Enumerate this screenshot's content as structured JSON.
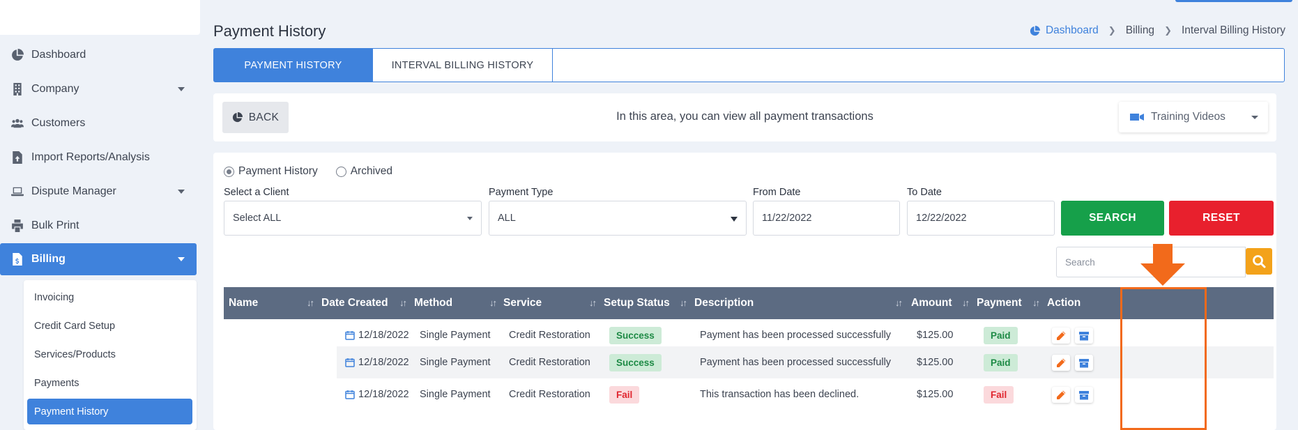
{
  "sidebar": {
    "items": [
      {
        "label": "Dashboard",
        "icon": "pie-chart-icon"
      },
      {
        "label": "Company",
        "icon": "building-icon"
      },
      {
        "label": "Customers",
        "icon": "users-icon"
      },
      {
        "label": "Import Reports/Analysis",
        "icon": "file-upload-icon"
      },
      {
        "label": "Dispute Manager",
        "icon": "laptop-icon"
      },
      {
        "label": "Bulk Print",
        "icon": "printer-icon"
      },
      {
        "label": "Billing",
        "icon": "invoice-icon"
      }
    ],
    "billing_submenu": [
      "Invoicing",
      "Credit Card Setup",
      "Services/Products",
      "Payments",
      "Payment History"
    ]
  },
  "header": {
    "title": "Payment History",
    "breadcrumb": [
      "Dashboard",
      "Billing",
      "Interval Billing History"
    ]
  },
  "tabs": [
    "PAYMENT HISTORY",
    "INTERVAL BILLING HISTORY"
  ],
  "info": {
    "back_label": "BACK",
    "text": "In this area, you can view all payment transactions",
    "training_label": "Training Videos"
  },
  "filters": {
    "radio_payment_history": "Payment History",
    "radio_archived": "Archived",
    "client_label": "Select a Client",
    "client_value": "Select ALL",
    "type_label": "Payment Type",
    "type_value": "ALL",
    "from_label": "From Date",
    "from_value": "11/22/2022",
    "to_label": "To Date",
    "to_value": "12/22/2022",
    "search_button": "SEARCH",
    "reset_button": "RESET",
    "search_placeholder": "Search"
  },
  "table": {
    "columns": [
      "Name",
      "Date Created",
      "Method",
      "Service",
      "Setup Status",
      "Description",
      "Amount",
      "Payment",
      "Action"
    ],
    "rows": [
      {
        "date": "12/18/2022",
        "method": "Single Payment",
        "service": "Credit Restoration",
        "status": "Success",
        "description": "Payment has been processed successfully",
        "amount": "$125.00",
        "payment": "Paid"
      },
      {
        "date": "12/18/2022",
        "method": "Single Payment",
        "service": "Credit Restoration",
        "status": "Success",
        "description": "Payment has been processed successfully",
        "amount": "$125.00",
        "payment": "Paid"
      },
      {
        "date": "12/18/2022",
        "method": "Single Payment",
        "service": "Credit Restoration",
        "status": "Fail",
        "description": "This transaction has been declined.",
        "amount": "$125.00",
        "payment": "Fail"
      }
    ]
  },
  "colors": {
    "accent": "#3f82dc",
    "search": "#16a04a",
    "reset": "#e8202d",
    "highlight": "#f26a1b"
  }
}
